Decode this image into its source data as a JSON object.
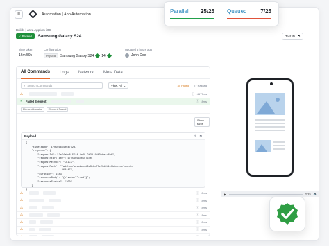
{
  "app": {
    "title": "Automation | App Automation"
  },
  "breadcrumb": "Builds  |  Java Appium iOS",
  "test": {
    "status": "Passed",
    "name": "Samsung Galaxy S24",
    "test_id_label": "Test ID"
  },
  "meta": {
    "time_taken_label": "Time taken",
    "time_taken": "16m 59s",
    "config_label": "Configuration",
    "config_chip": "Physical",
    "config_device": "Samsung Galaxy S24",
    "config_version": "14",
    "updated_label": "Updated 5 hours ago",
    "updated_by": "John Doe"
  },
  "tabs": [
    "All Commands",
    "Logs",
    "Network",
    "Meta Data"
  ],
  "toolbar": {
    "search_placeholder": "Search Commands",
    "view_label": "View: All",
    "failed_count": "40 Failed",
    "passed_count": "27 Passed"
  },
  "rows_top": [
    {
      "icon": "warning",
      "duration": "4677ms"
    },
    {
      "icon": "check",
      "failed_text": "Failed Element",
      "duration": "8ms"
    }
  ],
  "highlight_labels": [
    "Element Locator",
    "Element Found"
  ],
  "payload": {
    "title": "Payload",
    "code": "{\n    \"timestamp\": 1705666640647628,\n    \"response\": {\n        \"requestId\": \"2a74a0c8-5f1f-4a68-9b38-1df9b6e4d6e6\",\n        \"requestStartTime\": 1705666640597640,\n        \"requestMethod\": \"CLICK\",\n        \"requestPath\": \"/wd/hub/session/d6e3c8cf7e20d2b1c0b8cce/element/\n                        0631f7\",\n        \"duration\": 1183,\n        \"responseBody\": \"{\\\"value\\\":null}\",\n        \"responseStatus\": \"200\"\n    }\n}",
    "show_table": "Show table"
  },
  "rows_bottom": [
    {
      "icon": "warning",
      "duration": "8ms"
    },
    {
      "icon": "warning",
      "duration": "8ms"
    },
    {
      "icon": "warning",
      "duration": "8ms"
    },
    {
      "icon": "warning",
      "duration": "8ms"
    },
    {
      "icon": "warning",
      "duration": "8ms"
    },
    {
      "icon": "warning",
      "duration": "8ms"
    },
    {
      "icon": "warning",
      "duration": "8ms"
    }
  ],
  "player": {
    "time": "2:25"
  },
  "status": {
    "parallel_label": "Parallel",
    "parallel_value": "25/25",
    "queued_label": "Queued",
    "queued_value": "7/25",
    "parallel_color": "#22a04b",
    "queued_color": "#e0523a"
  },
  "colors": {
    "accent": "#e86a2d",
    "passed": "#1f8f3a"
  }
}
